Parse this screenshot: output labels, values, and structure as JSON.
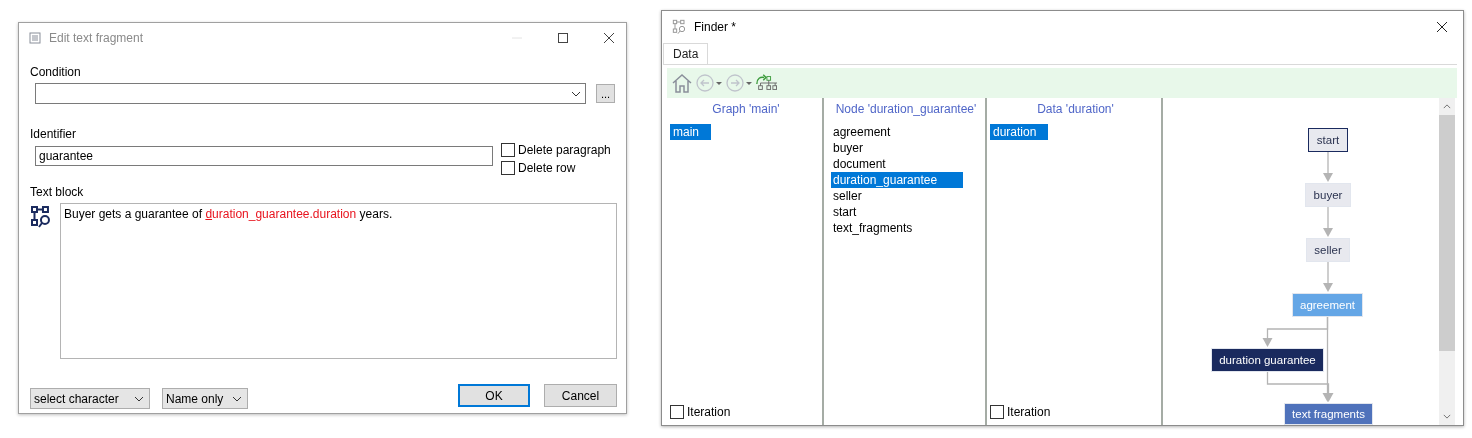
{
  "edit_dialog": {
    "title": "Edit text fragment",
    "condition": {
      "label": "Condition",
      "button": "..."
    },
    "identifier": {
      "label": "Identifier",
      "value": "guarantee"
    },
    "options": [
      {
        "label": "Delete paragraph",
        "checked": false
      },
      {
        "label": "Delete row",
        "checked": false
      }
    ],
    "text_block": {
      "label": "Text block",
      "segments": [
        {
          "text": "Buyer gets a guarantee of ",
          "kind": "plain"
        },
        {
          "text": "duration_guarantee.duration",
          "kind": "variable"
        },
        {
          "text": " years.",
          "kind": "plain"
        }
      ]
    },
    "character_select": "select character",
    "name_select": "Name only",
    "buttons": [
      {
        "label": "OK",
        "default": true
      },
      {
        "label": "Cancel",
        "default": false
      }
    ]
  },
  "finder": {
    "title": "Finder *",
    "tabs": [
      {
        "label": "Data",
        "selected": true
      }
    ],
    "columns": [
      {
        "header": "Graph 'main'",
        "items": [
          {
            "label": "main",
            "selected": true
          }
        ],
        "iteration": {
          "label": "Iteration",
          "checked": false
        }
      },
      {
        "header": "Node 'duration_guarantee'",
        "items": [
          {
            "label": "agreement",
            "selected": false
          },
          {
            "label": "buyer",
            "selected": false
          },
          {
            "label": "document",
            "selected": false
          },
          {
            "label": "duration_guarantee",
            "selected": true
          },
          {
            "label": "seller",
            "selected": false
          },
          {
            "label": "start",
            "selected": false
          },
          {
            "label": "text_fragments",
            "selected": false
          }
        ]
      },
      {
        "header": "Data 'duration'",
        "items": [
          {
            "label": "duration",
            "selected": true
          }
        ],
        "iteration": {
          "label": "Iteration",
          "checked": false
        }
      }
    ],
    "graph": {
      "nodes": [
        {
          "label": "start",
          "kind": "start",
          "color": "#e8e9ef"
        },
        {
          "label": "buyer",
          "kind": "step",
          "color": "#e8e9ef"
        },
        {
          "label": "seller",
          "kind": "step",
          "color": "#e8e9ef"
        },
        {
          "label": "agreement",
          "kind": "step",
          "color": "#64a6e6"
        },
        {
          "label": "duration guarantee",
          "kind": "step",
          "color": "#1a2a5e"
        },
        {
          "label": "text fragments",
          "kind": "step",
          "color": "#4f72bb"
        }
      ]
    }
  }
}
